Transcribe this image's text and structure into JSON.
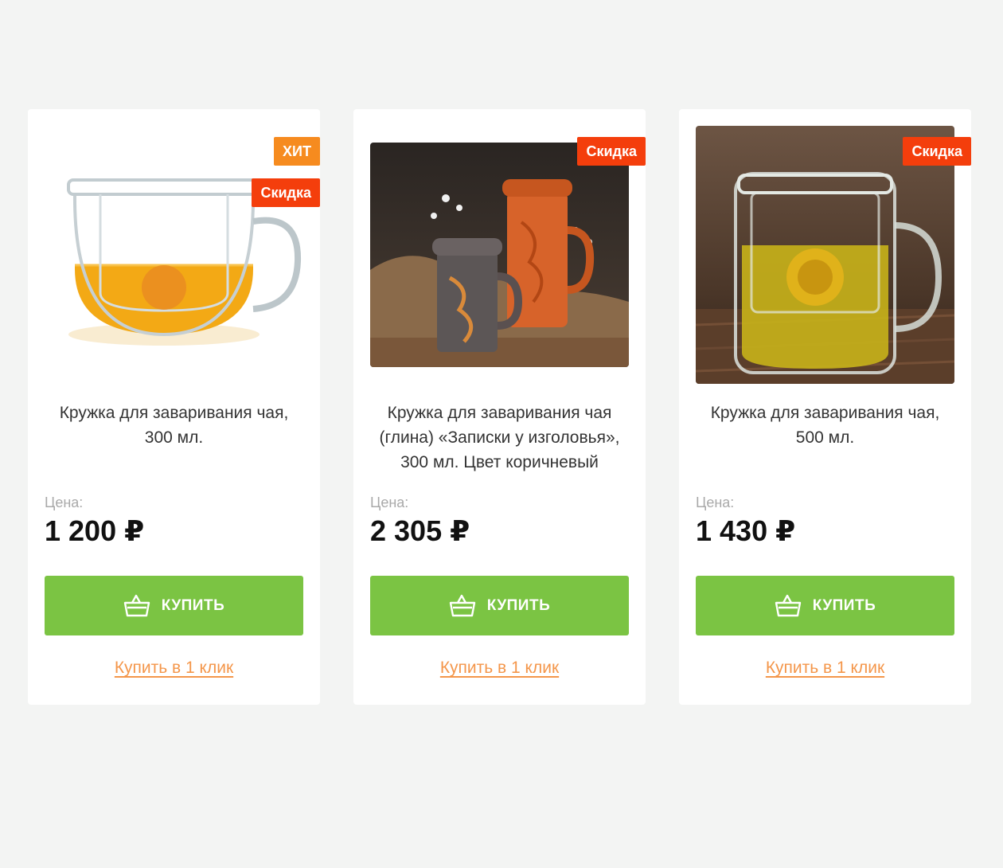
{
  "products": [
    {
      "title": "Кружка для заваривания чая, 300 мл.",
      "price_label": "Цена:",
      "price": "1 200 ₽",
      "buy_label": "КУПИТЬ",
      "one_click_label": "Купить в 1 клик",
      "badges": [
        "ХИТ",
        "Скидка"
      ],
      "image": "glass-tea-cup-amber"
    },
    {
      "title": "Кружка для заваривания чая (глина) «Записки у изголовья», 300 мл. Цвет коричневый",
      "price_label": "Цена:",
      "price": "2 305 ₽",
      "buy_label": "КУПИТЬ",
      "one_click_label": "Купить в 1 клик",
      "badges": [
        "Скидка"
      ],
      "image": "clay-tea-mugs"
    },
    {
      "title": "Кружка для заваривания чая, 500 мл.",
      "price_label": "Цена:",
      "price": "1 430 ₽",
      "buy_label": "КУПИТЬ",
      "one_click_label": "Купить в 1 клик",
      "badges": [
        "Скидка"
      ],
      "image": "glass-tea-mug-chrysanthemum"
    }
  ],
  "colors": {
    "background": "#f3f4f3",
    "card": "#ffffff",
    "buy_button": "#7bc443",
    "hit_badge": "#f68b1f",
    "sale_badge": "#f43e0c",
    "one_click_link": "#f4964a"
  }
}
